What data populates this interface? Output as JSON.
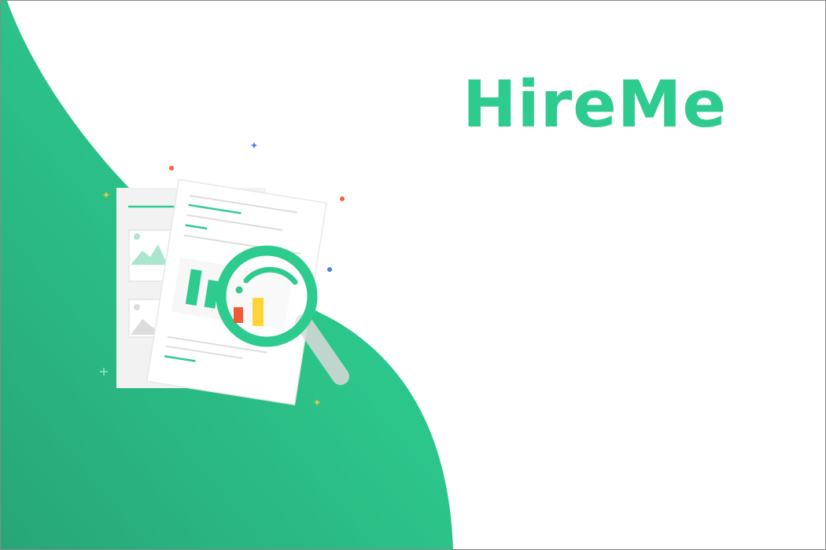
{
  "brand": {
    "name": "HireMe"
  },
  "colors": {
    "accent": "#2ecb8f",
    "accent_dark": "#27a678",
    "accent_light": "#2fd59a",
    "bar_orange": "#f15a37",
    "bar_yellow": "#ffd43b",
    "sparkle_red": "#f4623a",
    "sparkle_blue": "#4a7fe0",
    "sparkle_yellow": "#f2c744"
  },
  "illustration": {
    "icon": "document-search-icon"
  }
}
